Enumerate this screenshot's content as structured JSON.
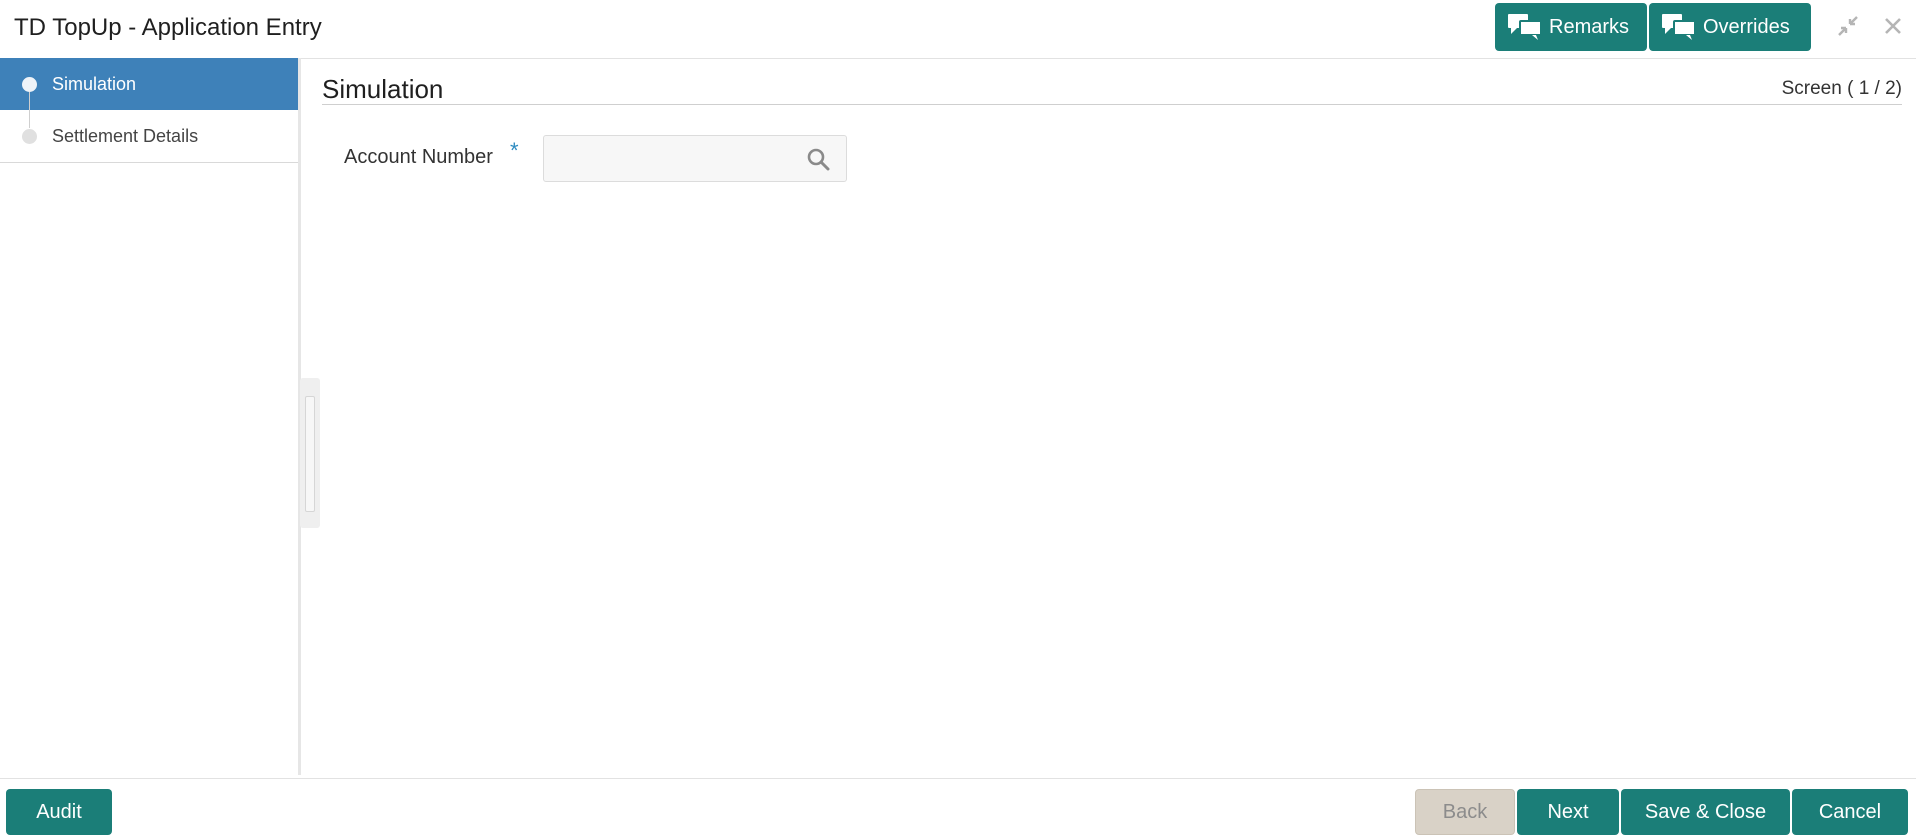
{
  "header": {
    "title": "TD TopUp - Application Entry",
    "remarks_label": "Remarks",
    "overrides_label": "Overrides",
    "remarks_icon": "chat-bubbles-icon",
    "overrides_icon": "chat-bubbles-icon",
    "minimize_icon": "collapse-icon",
    "close_icon": "close-icon"
  },
  "sidebar": {
    "steps": [
      {
        "label": "Simulation",
        "active": true
      },
      {
        "label": "Settlement Details",
        "active": false
      }
    ]
  },
  "main": {
    "title": "Simulation",
    "screen_indicator": "Screen ( 1 / 2)",
    "fields": {
      "account_number": {
        "label": "Account Number",
        "required_mark": "*",
        "value": "",
        "placeholder": ""
      }
    }
  },
  "footer": {
    "audit_label": "Audit",
    "back_label": "Back",
    "next_label": "Next",
    "save_close_label": "Save & Close",
    "cancel_label": "Cancel"
  },
  "colors": {
    "primary": "#1b7e78",
    "active_step": "#3e81b9",
    "disabled_button": "#d9d2c7",
    "required_mark": "#2e8bc0"
  }
}
